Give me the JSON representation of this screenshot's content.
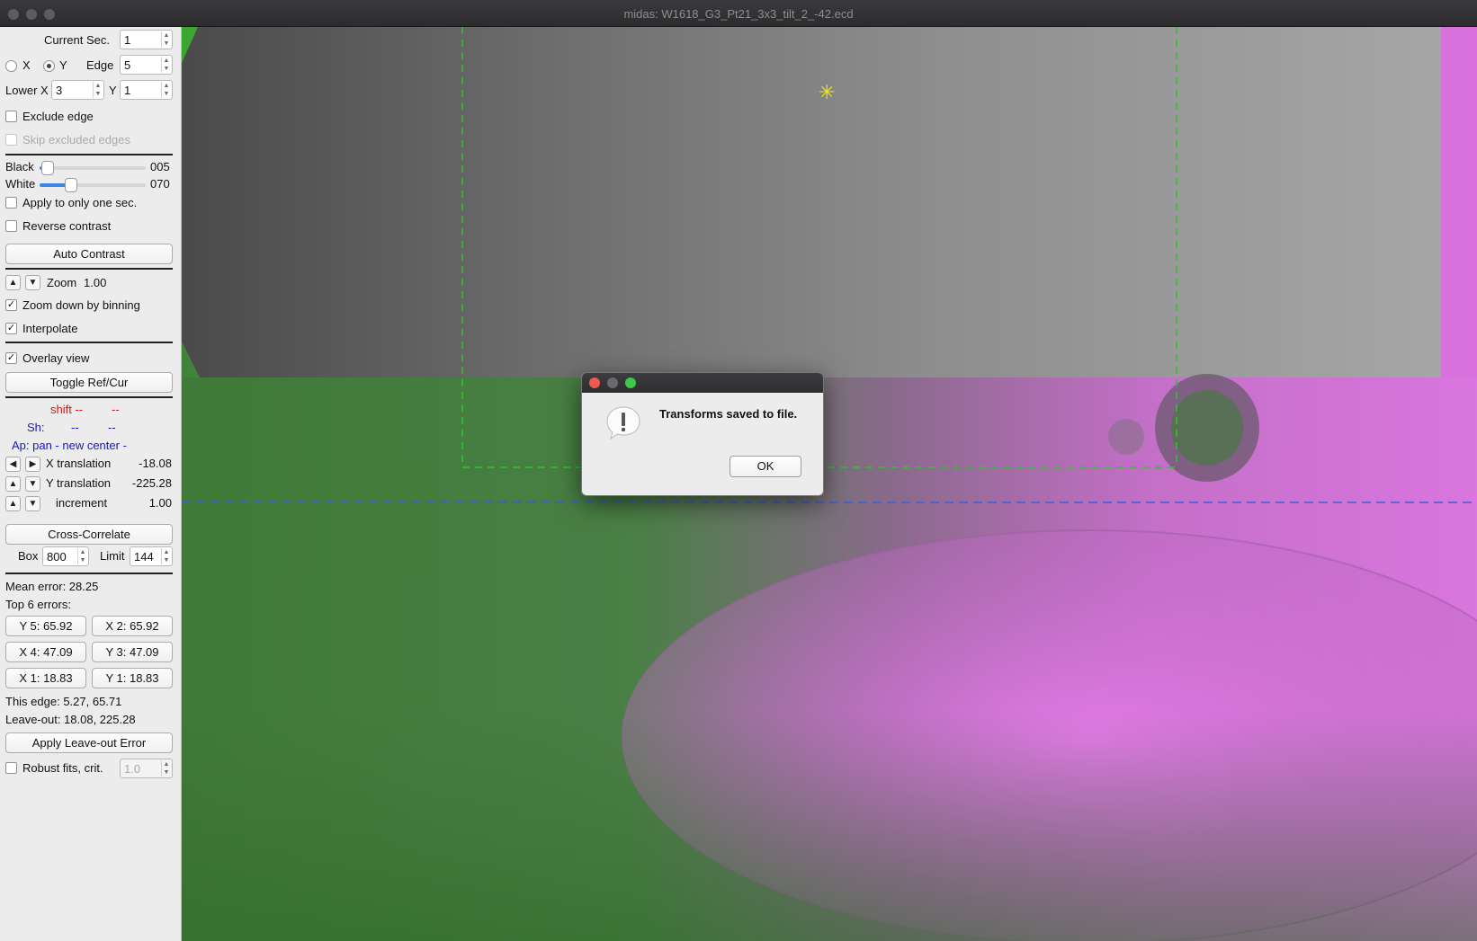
{
  "window": {
    "title": "midas: W1618_G3_Pt21_3x3_tilt_2_-42.ecd"
  },
  "panel": {
    "current_sec_label": "Current Sec.",
    "current_sec_value": "1",
    "radio_x_label": "X",
    "radio_y_label": "Y",
    "edge_label": "Edge",
    "edge_value": "5",
    "lower_x_label": "Lower X",
    "lower_x_value": "3",
    "lower_y_label": "Y",
    "lower_y_value": "1",
    "exclude_edge": "Exclude edge",
    "skip_excluded": "Skip excluded edges",
    "black_label": "Black",
    "black_value": "005",
    "black_level": 0.02,
    "white_label": "White",
    "white_value": "070",
    "white_level": 0.27,
    "apply_one_sec": "Apply to only one sec.",
    "reverse_contrast": "Reverse contrast",
    "auto_contrast": "Auto Contrast",
    "zoom_label": "Zoom",
    "zoom_value": "1.00",
    "zoom_down_binning": "Zoom down by binning",
    "interpolate": "Interpolate",
    "overlay_view": "Overlay view",
    "toggle_ref_cur": "Toggle Ref/Cur",
    "shift_label": "shift --",
    "shift_value": "--",
    "sh_label": "Sh:",
    "sh_v1": "--",
    "sh_v2": "--",
    "ap_text": "Ap: pan - new center -",
    "x_translation_label": "X translation",
    "x_translation_value": "-18.08",
    "y_translation_label": "Y translation",
    "y_translation_value": "-225.28",
    "increment_label": "increment",
    "increment_value": "1.00",
    "cross_correlate": "Cross-Correlate",
    "box_label": "Box",
    "box_value": "800",
    "limit_label": "Limit",
    "limit_value": "144",
    "mean_error": "Mean error: 28.25",
    "top_errors": "Top 6 errors:",
    "error_buttons": [
      "Y 5: 65.92",
      "X 2: 65.92",
      "X 4: 47.09",
      "Y 3: 47.09",
      "X 1: 18.83",
      "Y 1: 18.83"
    ],
    "this_edge": "This edge: 5.27, 65.71",
    "leave_out": "Leave-out: 18.08, 225.28",
    "apply_leave_out": "Apply Leave-out Error",
    "robust_fits": "Robust fits,  crit.",
    "crit_value": "1.0"
  },
  "dialog": {
    "message": "Transforms saved to file.",
    "ok_label": "OK"
  },
  "colors": {
    "green_overlay": "#3f7d3a",
    "magenta_overlay": "#e070e6",
    "guide_green": "#28c828",
    "guide_blue": "#3a5fd8",
    "marker_yellow": "#e8e820"
  },
  "icons": {
    "dialog_icon": "exclamation-icon",
    "marker": "asterisk-marker-icon"
  }
}
